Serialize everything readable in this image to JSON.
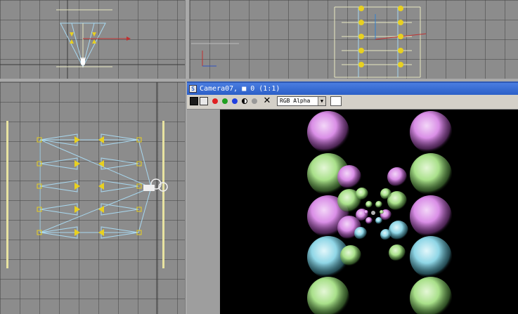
{
  "viewports": {
    "top": {
      "name": "top-viewport"
    },
    "front": {
      "name": "front-viewport"
    },
    "left": {
      "name": "left-viewport"
    }
  },
  "render_window": {
    "title": "Camera07, ■ 0 (1:1)",
    "channel_select": {
      "value": "RGB Alpha"
    },
    "toolbar_icons": [
      "save-icon",
      "clone-icon",
      "red-channel-icon",
      "green-channel-icon",
      "blue-channel-icon",
      "alpha-channel-icon",
      "mono-icon",
      "clear-icon"
    ],
    "colors": {
      "title_bar": "#2b5fc8",
      "red_channel": "#e02020",
      "green_channel": "#20a020",
      "blue_channel": "#2040e0",
      "sphere_pink": "#d98ee6",
      "sphere_green": "#a9e08a",
      "sphere_cyan": "#8fd6e6"
    }
  }
}
